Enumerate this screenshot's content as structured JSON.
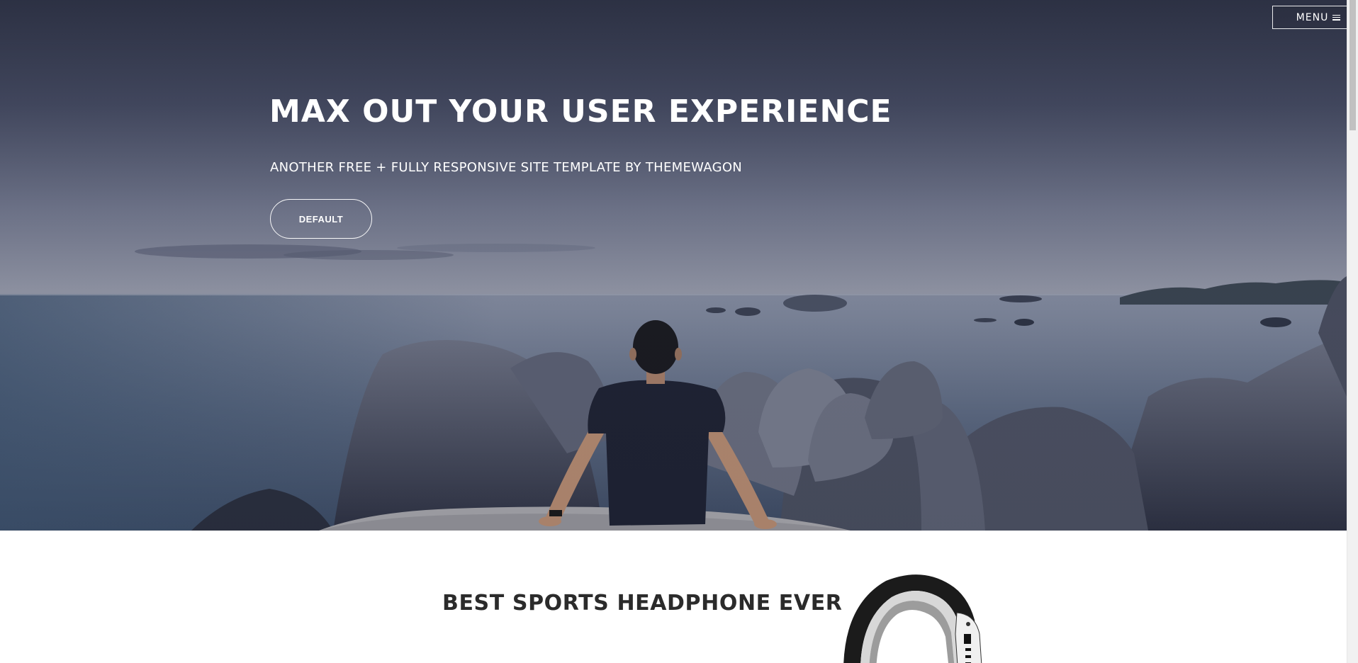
{
  "header": {
    "menu_label": "MENU",
    "menu_icon": "hamburger-icon"
  },
  "hero": {
    "title": "MAX OUT YOUR USER EXPERIENCE",
    "subtitle": "ANOTHER FREE + FULLY RESPONSIVE SITE TEMPLATE BY THEMEWAGON",
    "button_label": "DEFAULT"
  },
  "feature": {
    "title": "BEST SPORTS HEADPHONE EVER"
  },
  "colors": {
    "hero_text": "#ffffff",
    "feature_title": "#2b2b2b",
    "page_background": "#ffffff"
  }
}
